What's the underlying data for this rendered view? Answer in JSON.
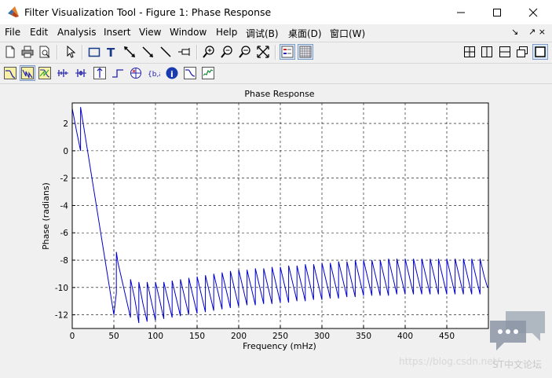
{
  "window": {
    "title": "Filter Visualization Tool - Figure 1: Phase Response",
    "controls": [
      "minimize",
      "maximize",
      "close"
    ]
  },
  "menu": {
    "items": [
      "File",
      "Edit",
      "Analysis",
      "Insert",
      "View",
      "Window",
      "Help",
      "调试(B)",
      "桌面(D)",
      "窗口(W)"
    ],
    "dock_left": "↘",
    "dock_right": "↗ ×"
  },
  "toolbar1": {
    "icons": [
      "new-icon",
      "print-icon",
      "print-preview-icon",
      "pointer-icon",
      "rectangle-icon",
      "text-icon",
      "double-arrow-icon",
      "arrow-icon",
      "line-icon",
      "pin-icon",
      "zoom-in-icon",
      "zoom-out-icon",
      "zoom-x-icon",
      "full-view-icon",
      "legend-icon",
      "grid-icon",
      "layout-2x2-icon",
      "layout-vertical-icon",
      "layout-horizontal-icon",
      "undock-icon",
      "single-view-icon"
    ]
  },
  "toolbar2": {
    "icons": [
      "magnitude-response-icon",
      "phase-response-icon",
      "magnitude-phase-icon",
      "group-delay-icon",
      "phase-delay-icon",
      "impulse-response-icon",
      "step-response-icon",
      "pole-zero-icon",
      "filter-coefficients-icon",
      "filter-info-icon",
      "magnitude-estimate-icon",
      "round-off-noise-icon"
    ],
    "pressed": "phase-response-icon"
  },
  "chart_data": {
    "type": "line",
    "title": "Phase Response",
    "xlabel": "Frequency (mHz)",
    "ylabel": "Phase (radians)",
    "xlim": [
      0,
      500
    ],
    "ylim": [
      -13,
      3.5
    ],
    "xticks": [
      0,
      50,
      100,
      150,
      200,
      250,
      300,
      350,
      400,
      450
    ],
    "yticks": [
      2,
      0,
      -2,
      -4,
      -6,
      -8,
      -10,
      -12
    ],
    "grid": true,
    "line_color": "#0000cc",
    "series": [
      {
        "x": [
          0,
          5,
          10,
          10,
          15,
          20,
          25,
          30,
          35,
          40,
          45,
          50,
          53,
          53,
          55,
          70,
          70,
          75,
          80,
          80,
          85,
          90,
          90,
          95,
          100,
          100,
          105,
          110,
          110,
          115,
          120,
          120,
          125,
          130,
          130,
          135,
          140,
          140,
          145,
          150,
          150,
          155,
          160,
          160,
          165,
          170,
          170,
          175,
          180,
          180,
          185,
          190,
          190,
          195,
          200,
          200,
          205,
          210,
          210,
          215,
          220,
          220,
          225,
          230,
          230,
          235,
          240,
          240,
          245,
          250,
          250,
          255,
          260,
          260,
          265,
          270,
          270,
          275,
          280,
          280,
          285,
          290,
          290,
          295,
          300,
          300,
          305,
          310,
          310,
          315,
          320,
          320,
          325,
          330,
          330,
          335,
          340,
          340,
          345,
          350,
          350,
          355,
          360,
          360,
          365,
          370,
          370,
          375,
          380,
          380,
          385,
          390,
          390,
          395,
          400,
          400,
          405,
          410,
          410,
          415,
          420,
          420,
          425,
          430,
          430,
          435,
          440,
          440,
          445,
          450,
          450,
          455,
          460,
          460,
          465,
          470,
          470,
          475,
          480,
          480,
          485,
          490,
          490,
          495,
          499
        ],
        "y": [
          3.1,
          1.5,
          0.0,
          3.2,
          1.3,
          -0.6,
          -2.5,
          -4.4,
          -6.3,
          -8.2,
          -10.1,
          -12.0,
          -10.4,
          -7.4,
          -8.2,
          -12.2,
          -9.4,
          -10.8,
          -12.6,
          -9.6,
          -11.2,
          -12.5,
          -9.6,
          -11.0,
          -12.4,
          -9.6,
          -10.9,
          -12.3,
          -9.6,
          -10.9,
          -12.2,
          -9.5,
          -10.8,
          -12.1,
          -9.4,
          -10.7,
          -12.0,
          -9.3,
          -10.6,
          -11.9,
          -9.2,
          -10.5,
          -11.8,
          -9.1,
          -10.4,
          -11.7,
          -9.0,
          -10.3,
          -11.6,
          -8.9,
          -10.2,
          -11.5,
          -8.8,
          -10.1,
          -11.4,
          -8.7,
          -10.0,
          -11.3,
          -8.7,
          -10.0,
          -11.3,
          -8.6,
          -9.9,
          -11.2,
          -8.6,
          -9.9,
          -11.2,
          -8.5,
          -9.8,
          -11.1,
          -8.5,
          -9.8,
          -11.1,
          -8.4,
          -9.7,
          -11.0,
          -8.4,
          -9.7,
          -11.0,
          -8.3,
          -9.6,
          -10.9,
          -8.3,
          -9.6,
          -10.9,
          -8.2,
          -9.5,
          -10.8,
          -8.2,
          -9.5,
          -10.8,
          -8.1,
          -9.4,
          -10.7,
          -8.1,
          -9.4,
          -10.7,
          -8.0,
          -9.3,
          -10.6,
          -8.0,
          -9.3,
          -10.6,
          -8.0,
          -9.3,
          -10.6,
          -8.0,
          -9.3,
          -10.6,
          -7.9,
          -9.2,
          -10.5,
          -7.9,
          -9.2,
          -10.5,
          -7.9,
          -9.2,
          -10.5,
          -7.9,
          -9.2,
          -10.5,
          -7.9,
          -9.2,
          -10.5,
          -7.9,
          -9.2,
          -10.5,
          -7.9,
          -9.2,
          -10.5,
          -7.9,
          -9.2,
          -10.5,
          -7.9,
          -9.2,
          -10.5,
          -7.9,
          -9.2,
          -10.5,
          -7.9,
          -9.2,
          -10.5,
          -7.9,
          -9.2,
          -10.0
        ]
      }
    ]
  },
  "watermark": {
    "url": "https://blog.csdn.net/",
    "brand": "ST中文论坛"
  }
}
